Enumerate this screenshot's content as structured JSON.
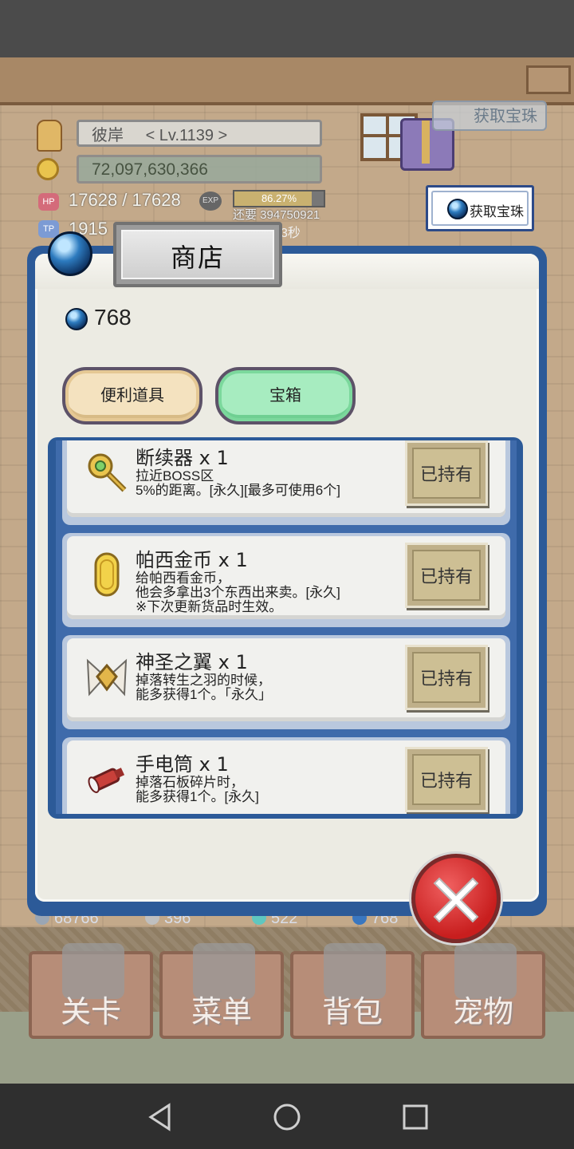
{
  "hud": {
    "player_name": "彼岸",
    "level": "< Lv.1139 >",
    "gold": "72,097,630,366",
    "hp_label": "HP",
    "hp": "17628 / 17628",
    "tp_label": "TP",
    "tp": "1915",
    "tp_suffix": "3秒",
    "exp_label": "EXP",
    "exp_percent": "86.27%",
    "exp_percent_value": 86.27,
    "exp_remaining": "还要 394750921",
    "get_gem_button": "获取宝珠",
    "add_gem_button": "获取宝珠"
  },
  "shop": {
    "title": "商店",
    "gem_balance": "768",
    "tabs": [
      {
        "label": "便利道具",
        "active": false
      },
      {
        "label": "宝箱",
        "active": true
      }
    ],
    "items": [
      {
        "name": "断续器 x 1",
        "desc": "拉近BOSS区\n5%的距离。[永久][最多可使用6个]",
        "button": "已持有",
        "icon": "scepter-icon"
      },
      {
        "name": "帕西金币 x 1",
        "desc": "给帕西看金币，\n他会多拿出3个东西出来卖。[永久]\n※下次更新货品时生效。",
        "button": "已持有",
        "icon": "gold-coin-icon"
      },
      {
        "name": "神圣之翼 x 1",
        "desc": "掉落转生之羽的时候，\n能多获得1个。「永久」",
        "button": "已持有",
        "icon": "holy-wings-icon"
      },
      {
        "name": "手电筒 x 1",
        "desc": "掉落石板碎片时，\n能多获得1个。[永久]",
        "button": "已持有",
        "icon": "flashlight-icon"
      }
    ]
  },
  "resources": [
    {
      "value": "68766",
      "icon": "stone-icon",
      "color": "#9aa6b4"
    },
    {
      "value": "396",
      "icon": "ore-icon",
      "color": "#bfbfbf"
    },
    {
      "value": "522",
      "icon": "teal-orb-icon",
      "color": "#5fc7c0"
    },
    {
      "value": "768",
      "icon": "gem-icon",
      "color": "#3a77c0"
    }
  ],
  "nav": [
    {
      "label": "关卡",
      "icon": "crossed-swords-icon"
    },
    {
      "label": "菜单",
      "icon": "book-icon"
    },
    {
      "label": "背包",
      "icon": "backpack-icon"
    },
    {
      "label": "宠物",
      "icon": "dragon-icon"
    }
  ],
  "colors": {
    "panel_border": "#2c5a98",
    "tab_active": "#a7ecc0",
    "tab_inactive": "#f4e2bf",
    "close_red": "#c81e1e"
  }
}
